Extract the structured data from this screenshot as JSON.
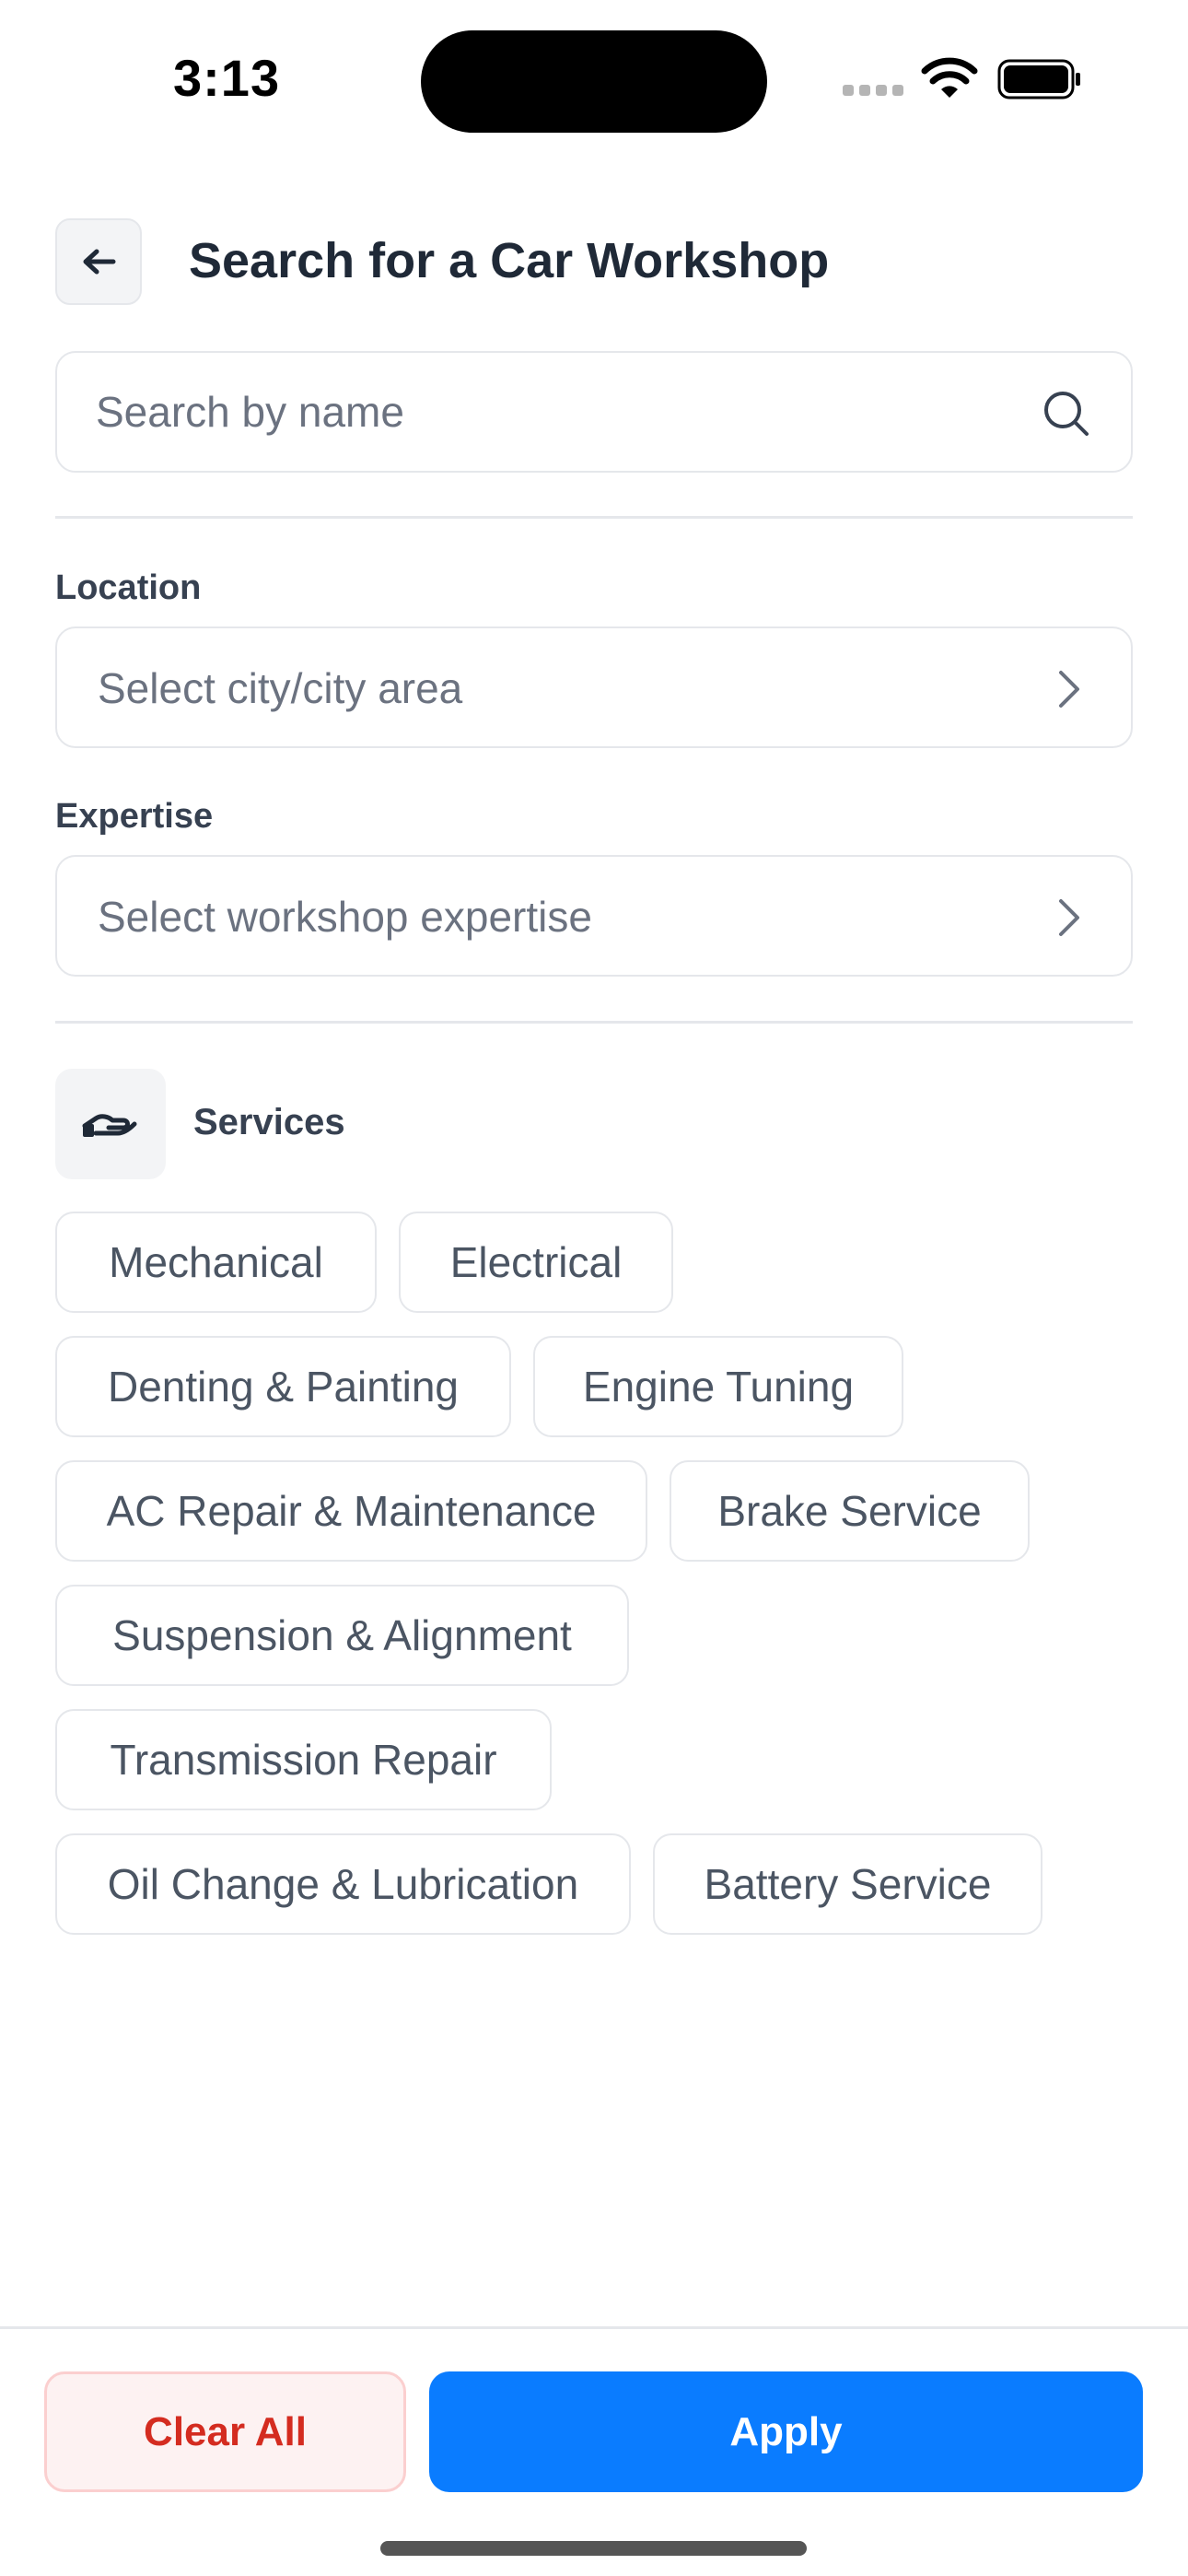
{
  "status_bar": {
    "time": "3:13"
  },
  "header": {
    "title": "Search for a Car Workshop"
  },
  "search": {
    "placeholder": "Search by name"
  },
  "location": {
    "label": "Location",
    "placeholder": "Select city/city area"
  },
  "expertise": {
    "label": "Expertise",
    "placeholder": "Select workshop expertise"
  },
  "services": {
    "title": "Services",
    "chips": [
      "Mechanical",
      "Electrical",
      "Denting & Painting",
      "Engine Tuning",
      "AC Repair & Maintenance",
      "Brake Service",
      "Suspension & Alignment",
      "Transmission Repair",
      "Oil Change & Lubrication",
      "Battery Service"
    ]
  },
  "actions": {
    "clear_label": "Clear All",
    "apply_label": "Apply"
  },
  "colors": {
    "primary": "#0a7cff",
    "danger": "#d42c20",
    "danger_bg": "#fdf2f2"
  }
}
